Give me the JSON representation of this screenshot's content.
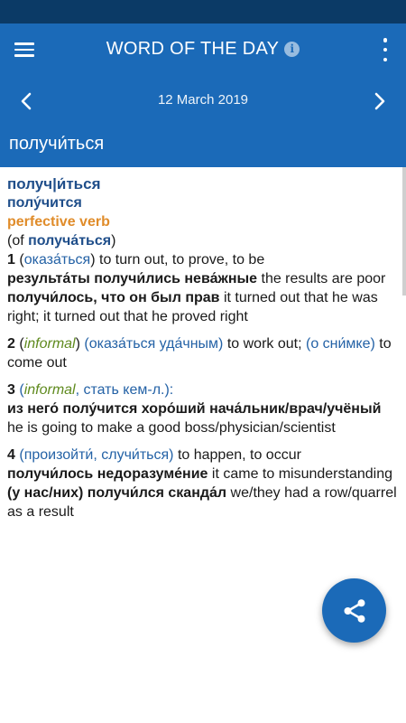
{
  "header": {
    "title": "WORD OF THE DAY",
    "info_icon": "info-icon",
    "menu_icon": "hamburger-menu-icon",
    "more_icon": "more-vertical-icon",
    "date": "12 March 2019",
    "headword": "получи́ться"
  },
  "colors": {
    "status_bar": "#0b3a66",
    "app_bar": "#1b6ab8",
    "entry_blue": "#1f4e8a",
    "part_of_speech_orange": "#e08c2a",
    "label_green": "#5f8a1e",
    "gloss_blue": "#2462a6"
  },
  "entry": {
    "headword_split": "получ|и́ться",
    "future_form": "полу́чится",
    "part_of_speech": "perfective verb",
    "aspect_prefix": "(of ",
    "aspect_pair": "получа́ться",
    "aspect_suffix": ")",
    "senses": [
      {
        "num": "1",
        "open": " (",
        "gloss": "оказа́ться",
        "close": ")",
        "translation": " to turn out, to prove, to be",
        "examples": [
          {
            "ru": "результа́ты получи́лись нева́жные",
            "en": " the results are poor"
          },
          {
            "ru": "получи́лось, что он был прав",
            "en": " it turned out that he was right; it turned out that he proved right"
          }
        ]
      },
      {
        "num": "2",
        "open": " (",
        "label": "informal",
        "close1": ") ",
        "gloss": "(оказа́ться уда́чным)",
        "translation": " to work out; ",
        "gloss2": "(о сни́мке)",
        "translation2": " to come out"
      },
      {
        "num": "3",
        "open": " (",
        "label": "informal",
        "gloss": ", стать кем-л.):",
        "examples": [
          {
            "ru": "из него́ полу́чится хоро́ший нача́льник/врач/учёный",
            "en": " he is going to make a good boss/physician/scientist"
          }
        ]
      },
      {
        "num": "4",
        "open": " ",
        "gloss": "(произойти́, случи́ться)",
        "translation": " to happen, to occur",
        "examples": [
          {
            "ru": "получи́лось недоразуме́ние",
            "en": " it came to misunderstanding"
          },
          {
            "ru": "(у нас/них) получи́лся сканда́л",
            "en": " we/they had a row/quarrel as a result"
          }
        ]
      }
    ]
  },
  "fab": {
    "icon": "share-icon"
  }
}
